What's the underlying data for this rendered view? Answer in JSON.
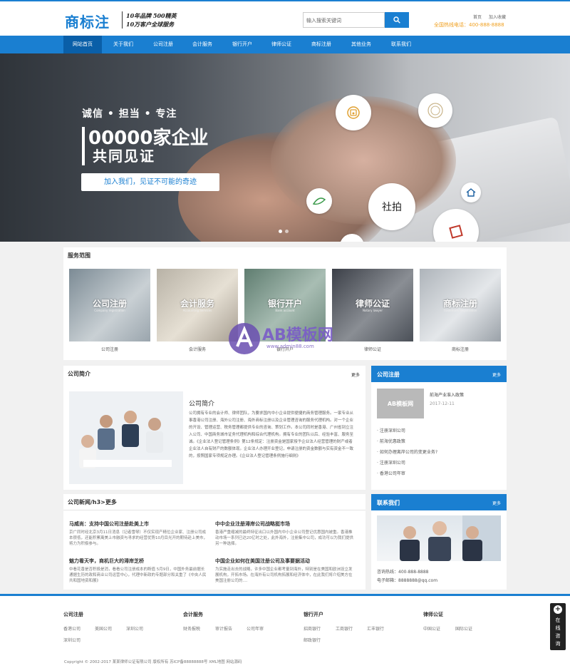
{
  "header": {
    "logo": "商标注",
    "slogan_line1": "10年品牌 500精英",
    "slogan_line2": "10万客户全球服务",
    "search_placeholder": "输入搜索关键词",
    "top_links": [
      "首页",
      "加入收藏"
    ],
    "hotline": "全国热线电话：400-888-8888"
  },
  "nav": {
    "items": [
      "网站首页",
      "关于我们",
      "公司注册",
      "会计服务",
      "银行开户",
      "律师公证",
      "商标注册",
      "其他业务",
      "联系我们"
    ],
    "active_index": 0
  },
  "banner": {
    "line1": "诚信 • 担当 • 专注",
    "line2": "00000家企业",
    "line3": "共同见证",
    "button": "加入我们，见证不可能的奇迹",
    "circle_text": "社拍",
    "slides": 2,
    "active_slide": 1
  },
  "services": {
    "title": "服务范围",
    "items": [
      {
        "title": "公司注册",
        "sub": "Company registration",
        "caption": "公司注册"
      },
      {
        "title": "会计服务",
        "sub": "Accounting Services",
        "caption": "会计服务"
      },
      {
        "title": "银行开户",
        "sub": "Bank account",
        "caption": "银行开户"
      },
      {
        "title": "律师公证",
        "sub": "Notary lawyer",
        "caption": "律师公证"
      },
      {
        "title": "商标注册",
        "sub": "Trademark Registration",
        "caption": "商标注册"
      }
    ]
  },
  "watermark": {
    "brand": "AB模板网",
    "url": "www.admin88.com"
  },
  "intro": {
    "title": "公司简介",
    "more": "更多",
    "heading": "公司简介",
    "body": "公司拥有专业的会计师、律师团队，为要求国内中小企业提供便捷的商务管理服务。一家专业从事香港公司注册、海外公司注册、海外商标注册以及企业管理咨询的服务代理机构。对一个企业的开设、管理运营、税务管理都提供专业的咨询、策划工作。本公司同时是香港、广州省到立注入公司、中国商务城市证务代理机构和综合代理机构。拥有专业的团队以后、经验丰富、服务至诚。《企业法人登记管理条例》第12条规定：注册资金是国家授予企业法人经营管理的财产或者企业法人自有财产的数额体现。企业法人办理开业登记，申请注册的资金数额与实有资金不一致的，按照国家专项规定办理。《企业法人登记管理条例施行细则》"
  },
  "news": {
    "title": "公司新闻/h3>更多",
    "items": [
      {
        "title": "马威尚：支持中国公司注册赴美上市",
        "desc": "京广同时经北京3月11日消息（记者雪琴）不仅实现产精位企业家、注册公司成本很低，还能积累离美上市融资与寻求的经营优势10月目光开的期待赴上美市，将力为积极参与。"
      },
      {
        "title": "中中企业注册滞岸公司战略挺市场",
        "desc": "香港严重缩减的最终特征出口以外国内中小企业公司登记优惠国内被重。香港推动市场一系列已达20亿时之处，此外海外，注册集中公司，成功可以为我们提供另一种选择。"
      },
      {
        "title": "魅力看天李，商机巨大的滞岸芝桥",
        "desc": "中看花香是否积极是消，看看公司注册成本的断值 5月9日，中国外务最前据长通据生历的政和商业公司运营中心，代理中新政的专题部分和关重了《中央人民共和国地资和展》"
      },
      {
        "title": "中国企业如何在美国注册公司及事要据活动",
        "desc": "为实施走出去的战略，许多中国企业都考量到海外，特别是在美国和欧洲设立发展机构，开拓市场。在海外有公司机构拓展和经济体中，在此我们将介绍美方在美国注册公司的...."
      }
    ]
  },
  "reg_sidebar": {
    "title": "公司注册",
    "more": "更多",
    "thumb_label": "AB模板网",
    "featured": {
      "title": "前海产业准入政策",
      "date": "2017-12-11"
    },
    "links": [
      "注册深圳公司",
      "前海优惠政策",
      "如何办理离岸公司的变更业务?",
      "注册深圳公司",
      "香港公司年审"
    ]
  },
  "contact": {
    "title": "联系我们",
    "more": "更多",
    "phone": "咨询热线：400-888-8888",
    "email": "电子邮箱：8888888@qq.com"
  },
  "footer": {
    "columns": [
      {
        "title": "公司注册",
        "links": [
          "香港公司",
          "美国公司",
          "深圳公司",
          "深圳公司"
        ]
      },
      {
        "title": "会计服务",
        "links": [
          "财务报税",
          "审计报告",
          "公司年审"
        ]
      },
      {
        "title": "银行开户",
        "links": [
          "招商银行",
          "工商银行",
          "汇丰银行",
          "邮政银行"
        ]
      },
      {
        "title": "律师公证",
        "links": [
          "中国公证",
          "国际公证"
        ]
      }
    ],
    "copyright": "Copyright © 2002-2017 某某律师公证有限公司 版权所有   苏ICP备88888888号   XML地图   网站源码"
  },
  "online": {
    "label": "在线咨询"
  },
  "colors": {
    "brand": "#1a7fd1",
    "nav_active": "#0a5fa8",
    "hotline": "#f0a020"
  }
}
